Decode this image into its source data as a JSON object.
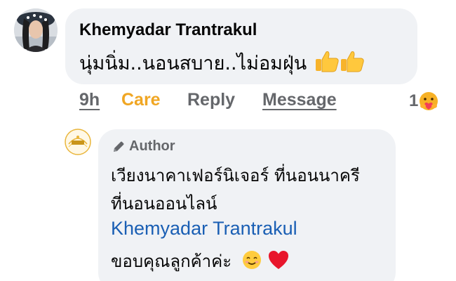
{
  "comment": {
    "author_name": "Khemyadar Trantrakul",
    "text": "นุ่มนิ่ม..นอนสบาย..ไม่อมฝุ่น",
    "emoji_icon": "thumbs-up-emoji"
  },
  "actions": {
    "time": "9h",
    "care": "Care",
    "reply": "Reply",
    "message": "Message",
    "care_color": "#f0a623"
  },
  "reactions": {
    "count": "1",
    "icon": "care-reaction-emoji"
  },
  "reply": {
    "badge": "Author",
    "line1": "เวียงนาคาเฟอร์นิเจอร์ ที่นอนนาครี",
    "line2": "ที่นอนออนไลน์",
    "mention": "Khemyadar Trantrakul",
    "mention_color": "#1a5fb4",
    "line4": "ขอบคุณลูกค้าค่ะ",
    "emojis": [
      "smiling-face-emoji",
      "red-heart-emoji"
    ]
  }
}
